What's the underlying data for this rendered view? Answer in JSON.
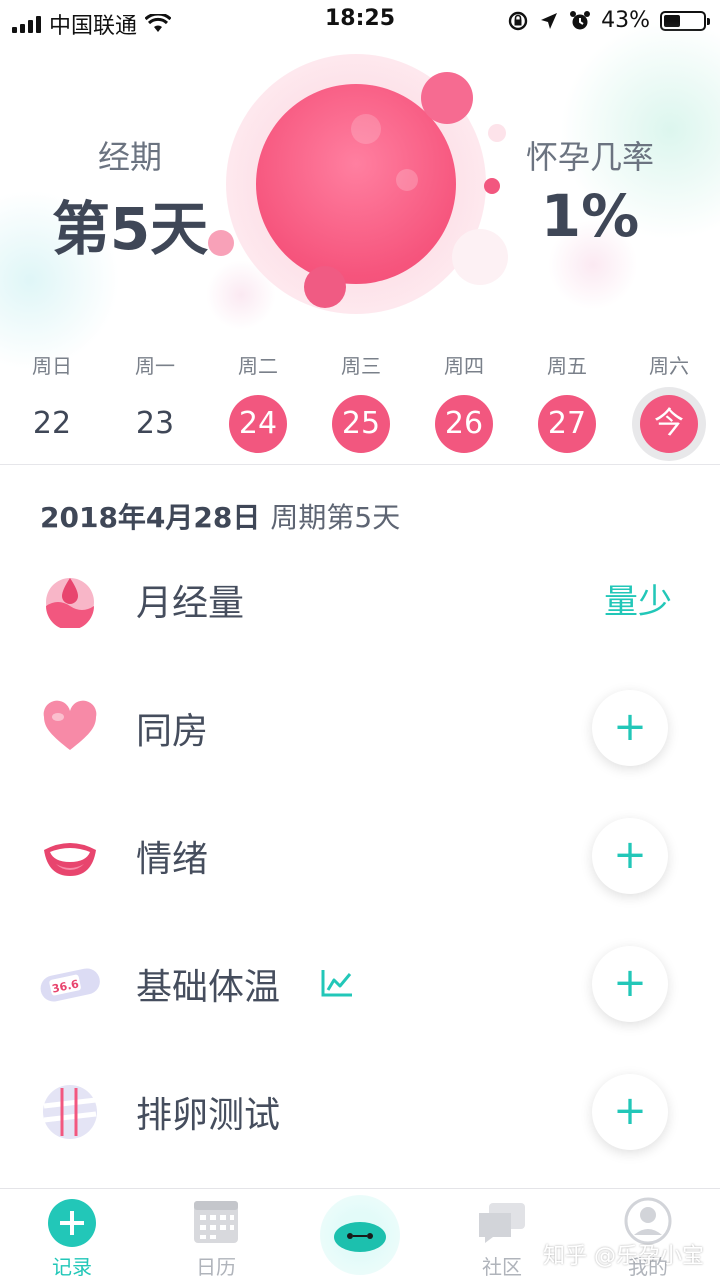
{
  "status_bar": {
    "carrier": "中国联通",
    "time": "18:25",
    "battery": "43%",
    "battery_level": 0.43
  },
  "hero": {
    "left_label": "经期",
    "left_value": "第5天",
    "right_label": "怀孕几率",
    "right_value": "1%"
  },
  "week": [
    {
      "weekday": "周日",
      "date": "22",
      "state": "normal"
    },
    {
      "weekday": "周一",
      "date": "23",
      "state": "normal"
    },
    {
      "weekday": "周二",
      "date": "24",
      "state": "period"
    },
    {
      "weekday": "周三",
      "date": "25",
      "state": "period"
    },
    {
      "weekday": "周四",
      "date": "26",
      "state": "period"
    },
    {
      "weekday": "周五",
      "date": "27",
      "state": "period"
    },
    {
      "weekday": "周六",
      "date": "今",
      "state": "today"
    }
  ],
  "date_line": {
    "date": "2018年4月28日",
    "cycle": "周期第5天"
  },
  "records": [
    {
      "name": "月经量",
      "value": "量少",
      "icon": "menstrual-flow-icon"
    },
    {
      "name": "同房",
      "icon": "heart-icon"
    },
    {
      "name": "情绪",
      "icon": "mouth-mood-icon"
    },
    {
      "name": "基础体温",
      "icon": "thermometer-icon",
      "thermometer_text": "36.6"
    },
    {
      "name": "排卵测试",
      "icon": "ovulation-test-strip-icon"
    }
  ],
  "plus_symbol": "+",
  "tabs": [
    {
      "label": "记录",
      "icon": "plus-circle-icon",
      "active": true
    },
    {
      "label": "日历",
      "icon": "calendar-icon"
    },
    {
      "label": "",
      "icon": "mascot-icon"
    },
    {
      "label": "社区",
      "icon": "chat-bubbles-icon"
    },
    {
      "label": "我的",
      "icon": "profile-icon"
    }
  ],
  "watermark": "知乎 @乐孕小宝",
  "colors": {
    "accent": "#22c7b8",
    "period": "#f2577f"
  }
}
